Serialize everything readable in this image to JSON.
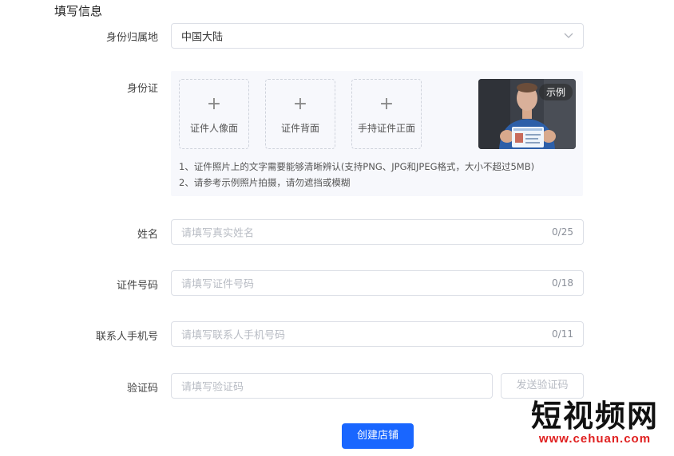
{
  "section_title": "填写信息",
  "region": {
    "label": "身份归属地",
    "value": "中国大陆"
  },
  "id_card": {
    "label": "身份证",
    "uploads": [
      {
        "label": "证件人像面"
      },
      {
        "label": "证件背面"
      },
      {
        "label": "手持证件正面"
      }
    ],
    "plus_symbol": "+",
    "sample_badge": "示例",
    "notes": [
      "1、证件照片上的文字需要能够清晰辨认(支持PNG、JPG和JPEG格式，大小不超过5MB)",
      "2、请参考示例照片拍摄，请勿遮挡或模糊"
    ]
  },
  "name": {
    "label": "姓名",
    "placeholder": "请填写真实姓名",
    "counter": "0/25"
  },
  "id_number": {
    "label": "证件号码",
    "placeholder": "请填写证件号码",
    "counter": "0/18"
  },
  "phone": {
    "label": "联系人手机号",
    "placeholder": "请填写联系人手机号码",
    "counter": "0/11"
  },
  "verify": {
    "label": "验证码",
    "placeholder": "请填写验证码",
    "send_button": "发送验证码"
  },
  "submit_button": "创建店铺",
  "watermark": {
    "text": "短视频网",
    "url": "www.cehuan.com"
  },
  "colors": {
    "primary": "#1966ff",
    "panel_background": "#f7f8fc",
    "border": "#dcdfe6",
    "placeholder": "#b8bcc4",
    "watermark_url": "#e02020"
  },
  "icons": [
    "chevron-down-icon",
    "plus-icon"
  ]
}
